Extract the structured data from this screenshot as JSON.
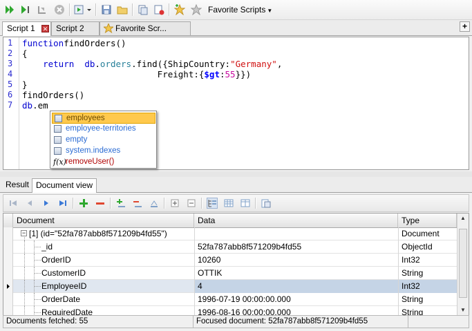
{
  "toolbar": {
    "buttons": [
      {
        "name": "run-icon"
      },
      {
        "name": "run-line-icon"
      },
      {
        "name": "step-icon"
      },
      {
        "name": "stop-icon"
      },
      {
        "name": "execute-dropdown-icon"
      },
      {
        "name": "save-icon"
      },
      {
        "name": "open-folder-icon"
      },
      {
        "name": "copy-script-icon"
      },
      {
        "name": "clear-script-icon"
      },
      {
        "name": "add-favorite-icon"
      },
      {
        "name": "favorites-star-icon"
      }
    ],
    "favorite_scripts_label": "Favorite Scripts"
  },
  "tabs": [
    {
      "label": "Script 1",
      "active": true
    },
    {
      "label": "Script 2",
      "active": false
    },
    {
      "label": "Favorite Scr...",
      "active": false
    }
  ],
  "editor": {
    "line_numbers": [
      "1",
      "2",
      "3",
      "4",
      "5",
      "6",
      "7"
    ],
    "lines": [
      {
        "parts": [
          [
            "kw",
            "function"
          ],
          [
            "",
            "findOrders()"
          ]
        ]
      },
      {
        "parts": [
          [
            "",
            "{"
          ]
        ]
      },
      {
        "parts": [
          [
            "",
            "    "
          ],
          [
            "kw",
            "return"
          ],
          [
            "",
            "  "
          ],
          [
            "kw",
            "db"
          ],
          [
            "",
            "."
          ],
          [
            "prop",
            "orders"
          ],
          [
            "",
            "."
          ],
          [
            "",
            "find({ShipCountry:"
          ],
          [
            "str",
            "\"Germany\""
          ],
          [
            "",
            ","
          ]
        ]
      },
      {
        "parts": [
          [
            "",
            "                          Freight:{"
          ],
          [
            "op",
            "$gt"
          ],
          [
            "",
            ":"
          ],
          [
            "num",
            "55"
          ],
          [
            "",
            "}})"
          ]
        ]
      },
      {
        "parts": [
          [
            "",
            "}"
          ]
        ]
      },
      {
        "parts": [
          [
            "",
            "findOrders()"
          ]
        ]
      },
      {
        "parts": [
          [
            "kw",
            "db"
          ],
          [
            "",
            ".em"
          ]
        ]
      }
    ]
  },
  "autocomplete": {
    "items": [
      {
        "label": "employees",
        "kind": "collection",
        "selected": true
      },
      {
        "label": "employee-territories",
        "kind": "collection",
        "selected": false
      },
      {
        "label": "empty",
        "kind": "collection",
        "selected": false
      },
      {
        "label": "system.indexes",
        "kind": "collection",
        "selected": false
      },
      {
        "label": "removeUser()",
        "kind": "function",
        "selected": false
      }
    ]
  },
  "result_tabs": [
    {
      "label": "Result",
      "active": false
    },
    {
      "label": "Document view",
      "active": true
    }
  ],
  "grid": {
    "columns": [
      "Document",
      "Data",
      "Type"
    ],
    "rows": [
      {
        "document": "[1] (id=\"52fa787abb8f571209b4fd55\")",
        "data": "",
        "type": "Document",
        "level": 0,
        "focused": false
      },
      {
        "document": "_id",
        "data": "52fa787abb8f571209b4fd55",
        "type": "ObjectId",
        "level": 1,
        "focused": false
      },
      {
        "document": "OrderID",
        "data": "10260",
        "type": "Int32",
        "level": 1,
        "focused": false
      },
      {
        "document": "CustomerID",
        "data": "OTTIK",
        "type": "String",
        "level": 1,
        "focused": false
      },
      {
        "document": "EmployeeID",
        "data": "4",
        "type": "Int32",
        "level": 1,
        "focused": true
      },
      {
        "document": "OrderDate",
        "data": "1996-07-19 00:00:00.000",
        "type": "String",
        "level": 1,
        "focused": false
      },
      {
        "document": "RequiredDate",
        "data": "1996-08-16 00:00:00.000",
        "type": "String",
        "level": 1,
        "focused": false
      }
    ]
  },
  "status": {
    "fetched": "Documents fetched: 55",
    "focused": "Focused document: 52fa787abb8f571209b4fd55"
  },
  "colors": {
    "keyword": "#0000d0",
    "string": "#d01010",
    "selection": "#ffc94d",
    "focus_row": "#c5d4e6"
  }
}
